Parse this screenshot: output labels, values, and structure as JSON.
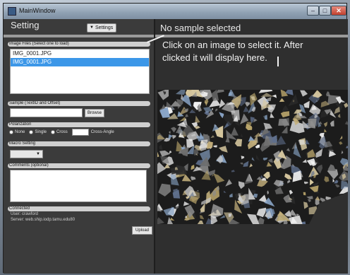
{
  "window": {
    "title": "MainWindow",
    "buttons": {
      "minimize": "–",
      "maximize": "□",
      "close": "✕"
    }
  },
  "left_panel": {
    "heading": "Setting",
    "settings_button_label": "Settings",
    "image_files": {
      "group_label": "Image Files (Select one to load)",
      "items": [
        {
          "label": "IMG_0001.JPG",
          "selected": false
        },
        {
          "label": "IMG_0001.JPG",
          "selected": true
        }
      ]
    },
    "sample": {
      "group_label": "Sample (TextID and Offset)",
      "input_value": "",
      "browse_label": "Browse"
    },
    "polarization": {
      "group_label": "Polarization",
      "options": [
        "None",
        "Single",
        "Cross"
      ],
      "cross_angle_value": "",
      "cross_angle_label": "Cross-Angle"
    },
    "macro": {
      "group_label": "Macro Setting",
      "selected_value": ""
    },
    "comments": {
      "group_label": "Comments (optional)",
      "value": ""
    },
    "connection": {
      "group_label": "Connected",
      "user_line": "User: crawford",
      "server_line": "Server: web.ship.iodp.tamu.edu80",
      "upload_label": "Upload"
    }
  },
  "right_panel": {
    "title": "No sample selected",
    "hint_line1": "Click on an image to select it.  After",
    "hint_line2": "clicked it will display here."
  },
  "colors": {
    "panel_bg": "#3b3b3b",
    "selection": "#3c97e8",
    "group_label_bg": "#cfcfcf",
    "close_button": "#c1402e"
  }
}
